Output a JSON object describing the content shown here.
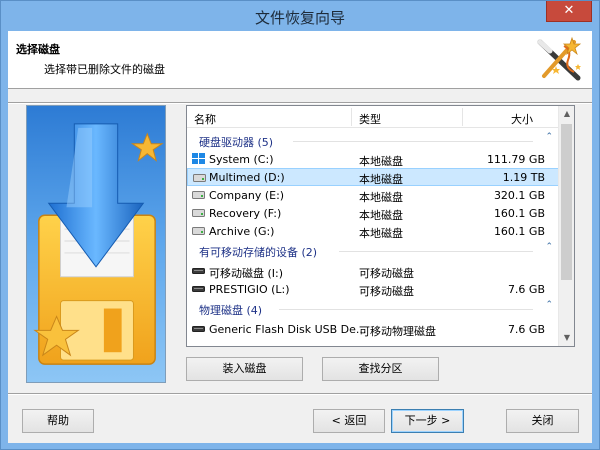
{
  "window": {
    "title": "文件恢复向导",
    "close_glyph": "✕"
  },
  "header": {
    "title": "选择磁盘",
    "subtitle": "选择带已删除文件的磁盘"
  },
  "list": {
    "columns": [
      "名称",
      "类型",
      "大小"
    ],
    "groups": [
      {
        "label": "硬盘驱动器 (5)",
        "caret": "⌃"
      },
      {
        "label": "有可移动存储的设备 (2)",
        "caret": "⌃"
      },
      {
        "label": "物理磁盘 (4)",
        "caret": "⌃"
      }
    ],
    "rows": [
      {
        "name": "System (C:)",
        "type": "本地磁盘",
        "size": "111.79 GB"
      },
      {
        "name": "Multimed (D:)",
        "type": "本地磁盘",
        "size": "1.19 TB"
      },
      {
        "name": "Company (E:)",
        "type": "本地磁盘",
        "size": "320.1 GB"
      },
      {
        "name": "Recovery (F:)",
        "type": "本地磁盘",
        "size": "160.1 GB"
      },
      {
        "name": "Archive (G:)",
        "type": "本地磁盘",
        "size": "160.1 GB"
      },
      {
        "name": "可移动磁盘 (I:)",
        "type": "可移动磁盘",
        "size": ""
      },
      {
        "name": "PRESTIGIO (L:)",
        "type": "可移动磁盘",
        "size": "7.6 GB"
      },
      {
        "name": "Generic Flash Disk USB De...",
        "type": "可移动物理磁盘",
        "size": "7.6 GB"
      }
    ],
    "selected_row": "Multimed (D:)",
    "scroll_up": "▲",
    "scroll_down": "▼"
  },
  "buttons": {
    "mount": "装入磁盘",
    "find_partition": "查找分区",
    "help": "帮助",
    "back": "< 返回",
    "next": "下一步 >",
    "close": "关闭"
  },
  "colors": {
    "title_bar": "#7eb4ea",
    "group_text": "#1e3287",
    "selection": "#cce8ff",
    "close_red": "#c74a3c"
  },
  "icons": {
    "wizard": "magic-wand-icon",
    "system_drive": "windows-drive-icon",
    "drive": "hard-drive-icon",
    "removable": "removable-drive-icon"
  }
}
